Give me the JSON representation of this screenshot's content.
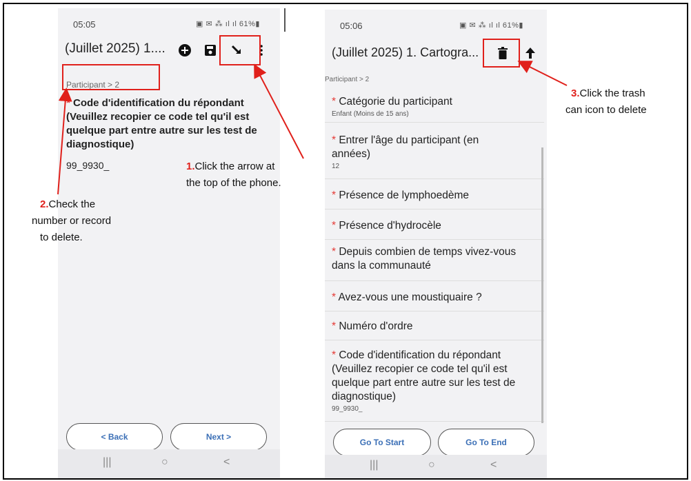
{
  "phone1": {
    "time": "05:05",
    "status_icons": "▣ ✉ ⁂ ıl ıl 61%▮",
    "title": "(Juillet 2025) 1....",
    "breadcrumb": "Participant > 2",
    "question": "Code d'identification du répondant (Veuillez recopier ce code tel qu'il est quelque part entre autre sur les test de diagnostique)",
    "answer": "99_9930_",
    "back_label": "< Back",
    "next_label": "Next >",
    "toolbar_icons": [
      "add-icon",
      "save-icon",
      "arrow-icon",
      "more-icon"
    ]
  },
  "phone2": {
    "time": "05:06",
    "status_icons": "▣ ✉ ⁂ ıl ıl 61%▮",
    "title": "(Juillet 2025) 1. Cartogra...",
    "breadcrumb": "Participant > 2",
    "questions": [
      {
        "label": "Catégorie du participant",
        "value": "Enfant (Moins de 15 ans)"
      },
      {
        "label": "Entrer l'âge du participant (en années)",
        "value": "12"
      },
      {
        "label": "Présence de lymphoedème",
        "value": ""
      },
      {
        "label": "Présence d'hydrocèle",
        "value": ""
      },
      {
        "label": "Depuis combien de temps vivez-vous dans la communauté",
        "value": ""
      },
      {
        "label": "Avez-vous une moustiquaire ?",
        "value": ""
      },
      {
        "label": "Numéro d'ordre",
        "value": ""
      },
      {
        "label": "Code d'identification du répondant (Veuillez recopier ce code tel qu'il est quelque part entre autre sur les test de diagnostique)",
        "value": "99_9930_"
      }
    ],
    "go_start_label": "Go To Start",
    "go_end_label": "Go To End",
    "toolbar_icons": [
      "trash-icon",
      "upload-icon"
    ]
  },
  "annotations": {
    "step1_num": "1.",
    "step1_text_a": "Click the arrow at",
    "step1_text_b": "the top of the phone.",
    "step2_num": "2.",
    "step2_text_a": "Check the",
    "step2_text_b": "number or record",
    "step2_text_c": "to delete.",
    "step3_num": "3.",
    "step3_text_a": "Click the trash",
    "step3_text_b": "can icon to delete"
  },
  "colors": {
    "accent_red": "#e0201b",
    "button_blue": "#3b6fb6",
    "required": "#e53935"
  }
}
